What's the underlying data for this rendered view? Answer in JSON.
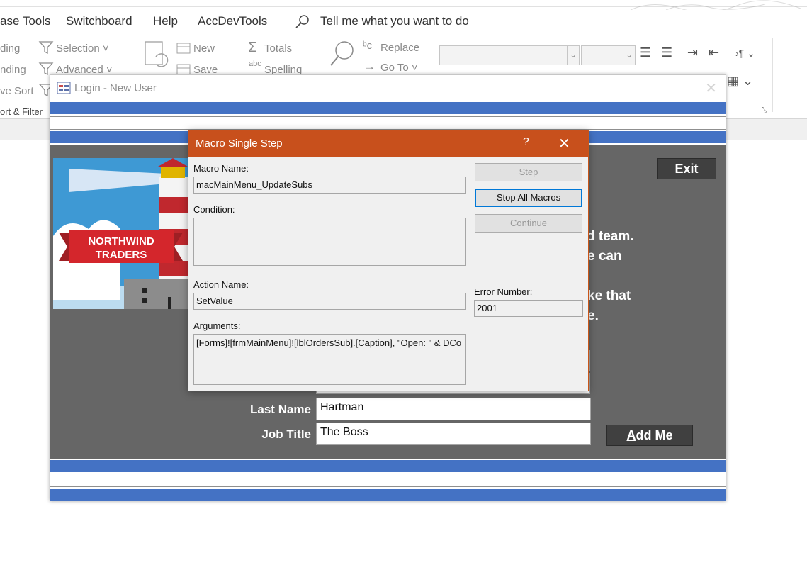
{
  "menu": {
    "tabs": [
      "ase Tools",
      "Switchboard",
      "Help",
      "AccDevTools"
    ],
    "tell_me": "Tell me what you want to do"
  },
  "ribbon": {
    "sort_filter": {
      "partial_top": "ding",
      "partial_mid": "nding",
      "partial_low": "ve Sort",
      "selection": "Selection",
      "advanced": "Advanced",
      "group_label": "ort & Filter"
    },
    "records": {
      "refresh_partial": "Refresh",
      "new": "New",
      "save": "Save",
      "totals": "Totals",
      "spelling": "Spelling"
    },
    "find": {
      "find": "Find",
      "replace": "Replace",
      "goto": "Go To"
    }
  },
  "login_form": {
    "title": "Login - New User",
    "exit_label": "Exit",
    "bg_lines": [
      "d team.",
      "e can",
      "ke that",
      "e."
    ],
    "fields": [
      {
        "label": "Last Name",
        "value": "Hartman"
      },
      {
        "label": "Job Title",
        "value": "The Boss"
      }
    ],
    "add_me_label": "Add Me",
    "add_me_accel": "A",
    "add_me_rest": "dd Me",
    "logo_text": [
      "NORTHWIND",
      "TRADERS"
    ]
  },
  "macro_dialog": {
    "title": "Macro Single Step",
    "help_glyph": "?",
    "macro_name_label": "Macro Name:",
    "macro_name": "macMainMenu_UpdateSubs",
    "condition_label": "Condition:",
    "condition": "",
    "action_name_label": "Action Name:",
    "action_name": "SetValue",
    "arguments_label": "Arguments:",
    "arguments": "[Forms]![frmMainMenu]![lblOrdersSub].[Caption], \"Open: \" & DCo",
    "error_number_label": "Error Number:",
    "error_number": "2001",
    "buttons": {
      "step": "Step",
      "stop_all": "Stop All Macros",
      "continue": "Continue"
    }
  }
}
